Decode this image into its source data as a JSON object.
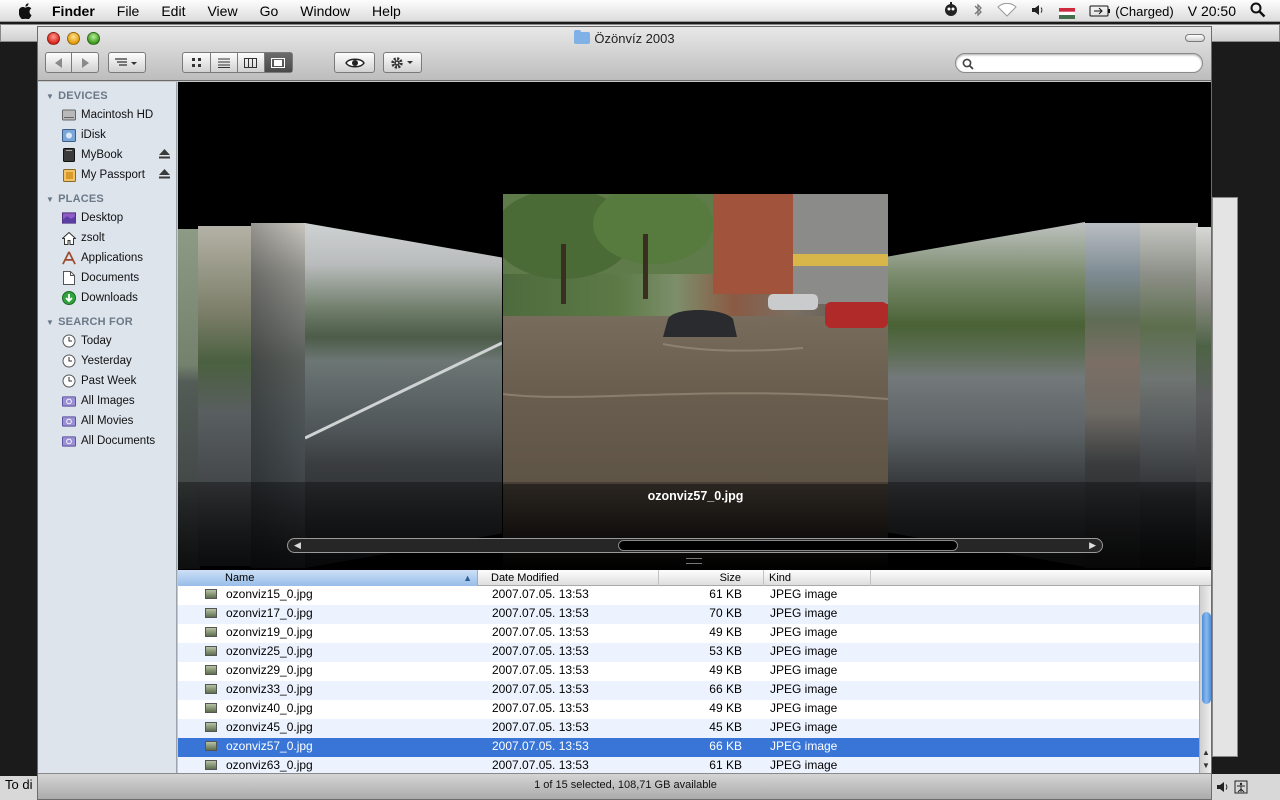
{
  "menubar": {
    "app_name": "Finder",
    "menus": [
      "File",
      "Edit",
      "View",
      "Go",
      "Window",
      "Help"
    ],
    "status": {
      "battery": "(Charged)",
      "clock": "V 20:50"
    }
  },
  "window": {
    "title": "Özönvíz 2003",
    "search_placeholder": ""
  },
  "sidebar": {
    "devices_heading": "DEVICES",
    "devices": [
      {
        "label": "Macintosh HD",
        "icon": "hard-drive-icon"
      },
      {
        "label": "iDisk",
        "icon": "idisk-icon"
      },
      {
        "label": "MyBook",
        "icon": "external-drive-icon"
      },
      {
        "label": "My Passport",
        "icon": "external-drive-icon"
      }
    ],
    "places_heading": "PLACES",
    "places": [
      {
        "label": "Desktop",
        "icon": "desktop-icon"
      },
      {
        "label": "zsolt",
        "icon": "home-icon"
      },
      {
        "label": "Applications",
        "icon": "applications-icon"
      },
      {
        "label": "Documents",
        "icon": "documents-icon"
      },
      {
        "label": "Downloads",
        "icon": "downloads-icon"
      }
    ],
    "search_heading": "SEARCH FOR",
    "searches": [
      {
        "label": "Today",
        "icon": "clock-icon"
      },
      {
        "label": "Yesterday",
        "icon": "clock-icon"
      },
      {
        "label": "Past Week",
        "icon": "clock-icon"
      },
      {
        "label": "All Images",
        "icon": "smart-folder-icon"
      },
      {
        "label": "All Movies",
        "icon": "smart-folder-icon"
      },
      {
        "label": "All Documents",
        "icon": "smart-folder-icon"
      }
    ]
  },
  "coverflow": {
    "caption": "ozonviz57_0.jpg"
  },
  "list": {
    "columns": {
      "name": "Name",
      "date": "Date Modified",
      "size": "Size",
      "kind": "Kind"
    },
    "rows": [
      {
        "name": "ozonviz15_0.jpg",
        "date": "2007.07.05. 13:53",
        "size": "61 KB",
        "kind": "JPEG image"
      },
      {
        "name": "ozonviz17_0.jpg",
        "date": "2007.07.05. 13:53",
        "size": "70 KB",
        "kind": "JPEG image"
      },
      {
        "name": "ozonviz19_0.jpg",
        "date": "2007.07.05. 13:53",
        "size": "49 KB",
        "kind": "JPEG image"
      },
      {
        "name": "ozonviz25_0.jpg",
        "date": "2007.07.05. 13:53",
        "size": "53 KB",
        "kind": "JPEG image"
      },
      {
        "name": "ozonviz29_0.jpg",
        "date": "2007.07.05. 13:53",
        "size": "49 KB",
        "kind": "JPEG image"
      },
      {
        "name": "ozonviz33_0.jpg",
        "date": "2007.07.05. 13:53",
        "size": "66 KB",
        "kind": "JPEG image"
      },
      {
        "name": "ozonviz40_0.jpg",
        "date": "2007.07.05. 13:53",
        "size": "49 KB",
        "kind": "JPEG image"
      },
      {
        "name": "ozonviz45_0.jpg",
        "date": "2007.07.05. 13:53",
        "size": "45 KB",
        "kind": "JPEG image"
      },
      {
        "name": "ozonviz57_0.jpg",
        "date": "2007.07.05. 13:53",
        "size": "66 KB",
        "kind": "JPEG image",
        "selected": true
      },
      {
        "name": "ozonviz63_0.jpg",
        "date": "2007.07.05. 13:53",
        "size": "61 KB",
        "kind": "JPEG image"
      }
    ]
  },
  "statusbar": {
    "text": "1 of 15 selected, 108,71 GB available"
  },
  "behind_window": {
    "text": "To di"
  },
  "colors": {
    "selection": "#3875d7",
    "sidebar_bg": "#dde4ec",
    "coverflow_bg": "#000000"
  }
}
